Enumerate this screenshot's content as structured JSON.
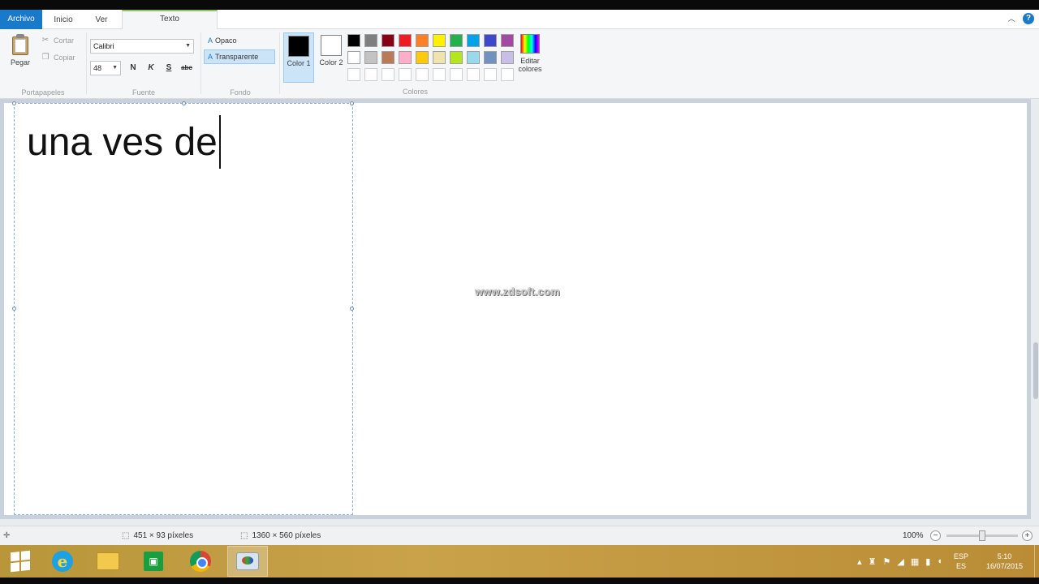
{
  "tabs": {
    "file": "Archivo",
    "home": "Inicio",
    "view": "Ver",
    "text": "Texto"
  },
  "ribbon": {
    "clipboard": {
      "paste": "Pegar",
      "cut": "Cortar",
      "copy": "Copiar",
      "label": "Portapapeles"
    },
    "font": {
      "family": "Calibri",
      "size": "48",
      "bold": "N",
      "italic": "K",
      "underline": "S",
      "strike": "abc",
      "label": "Fuente"
    },
    "background": {
      "opaque": "Opaco",
      "transparent": "Transparente",
      "label": "Fondo"
    },
    "colors": {
      "color1": "Color 1",
      "color2": "Color 2",
      "edit": "Editar colores",
      "label": "Colores",
      "color1_value": "#000000",
      "color2_value": "#ffffff",
      "palette_row1": [
        "#000000",
        "#7f7f7f",
        "#880015",
        "#ed1c24",
        "#ff7f27",
        "#fff200",
        "#22b14c",
        "#00a2e8",
        "#3f48cc",
        "#a349a4"
      ],
      "palette_row2": [
        "#ffffff",
        "#c3c3c3",
        "#b97a57",
        "#ffaec9",
        "#ffc90e",
        "#efe4b0",
        "#b5e61d",
        "#99d9ea",
        "#7092be",
        "#c8bfe7"
      ]
    }
  },
  "canvas": {
    "text": "una ves de",
    "watermark": "www.zdsoft.com"
  },
  "status": {
    "selection": "451 × 93 píxeles",
    "image_size": "1360 × 560 píxeles",
    "zoom": "100%"
  },
  "taskbar": {
    "lang_top": "ESP",
    "lang_bottom": "ES",
    "time": "5:10",
    "date": "16/07/2015"
  }
}
